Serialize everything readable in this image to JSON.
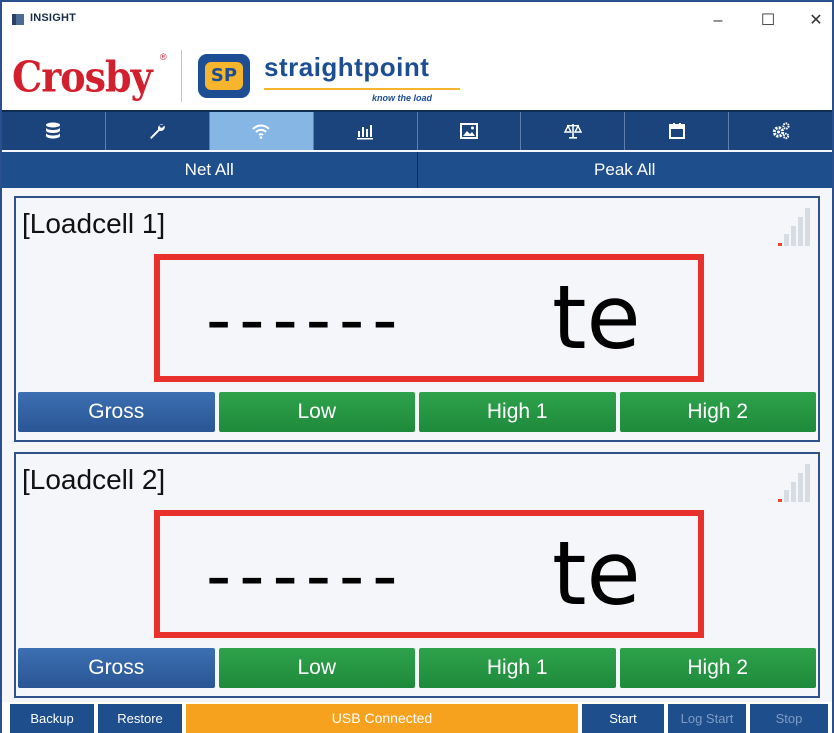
{
  "window": {
    "title": "INSIGHT",
    "controls": {
      "minimize": "–",
      "maximize": "☐",
      "close": "✕"
    }
  },
  "branding": {
    "crosby": "Crosby",
    "crosby_mark": "®",
    "sp_initials": "SP",
    "straightpoint": "straightpoint",
    "tagline": "know the load"
  },
  "toolbar": {
    "items": [
      {
        "icon": "database-icon",
        "active": false
      },
      {
        "icon": "wrench-icon",
        "active": false
      },
      {
        "icon": "wifi-icon",
        "active": true
      },
      {
        "icon": "bar-chart-icon",
        "active": false
      },
      {
        "icon": "image-icon",
        "active": false
      },
      {
        "icon": "scale-icon",
        "active": false
      },
      {
        "icon": "calendar-icon",
        "active": false
      },
      {
        "icon": "settings-icon",
        "active": false
      }
    ]
  },
  "subbar": {
    "net_all": "Net All",
    "peak_all": "Peak All"
  },
  "loadcells": [
    {
      "title": "[Loadcell 1]",
      "value": "------",
      "unit": "te",
      "buttons": [
        "Gross",
        "Low",
        "High 1",
        "High 2"
      ]
    },
    {
      "title": "[Loadcell 2]",
      "value": "------",
      "unit": "te",
      "buttons": [
        "Gross",
        "Low",
        "High 1",
        "High 2"
      ]
    }
  ],
  "statusbar": {
    "backup": "Backup",
    "restore": "Restore",
    "status": "USB Connected",
    "start": "Start",
    "log_start": "Log Start",
    "stop": "Stop"
  },
  "colors": {
    "nav_blue": "#1b447c",
    "active_tab": "#86b6e4",
    "status_orange": "#f7a21e",
    "alarm_red": "#e8312c",
    "mode_green": "#1e8a3b"
  }
}
